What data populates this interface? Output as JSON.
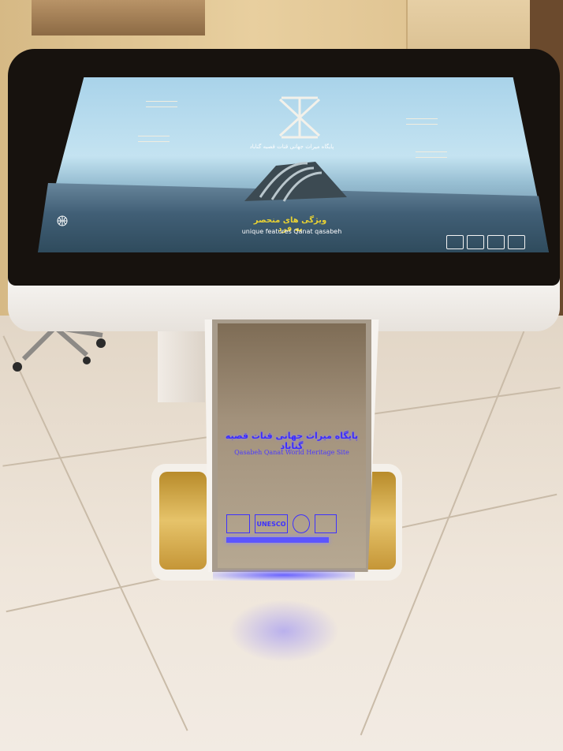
{
  "screen": {
    "title": "پایگاه میراث جهانی قنات قصبه گناباد",
    "feature_title": "ویژگی های منحصر به فرد",
    "feature_subtitle": "unique features Qanat qasabeh"
  },
  "pedestal": {
    "title_fa": "پایگاه میراث جهانی قنات قصبه گناباد",
    "title_en": "Qasabeh Qanat World Heritage Site",
    "logo_label": "UNESCO"
  },
  "colors": {
    "accent_blue": "#3d31ff",
    "gold": "#e6c36a"
  }
}
